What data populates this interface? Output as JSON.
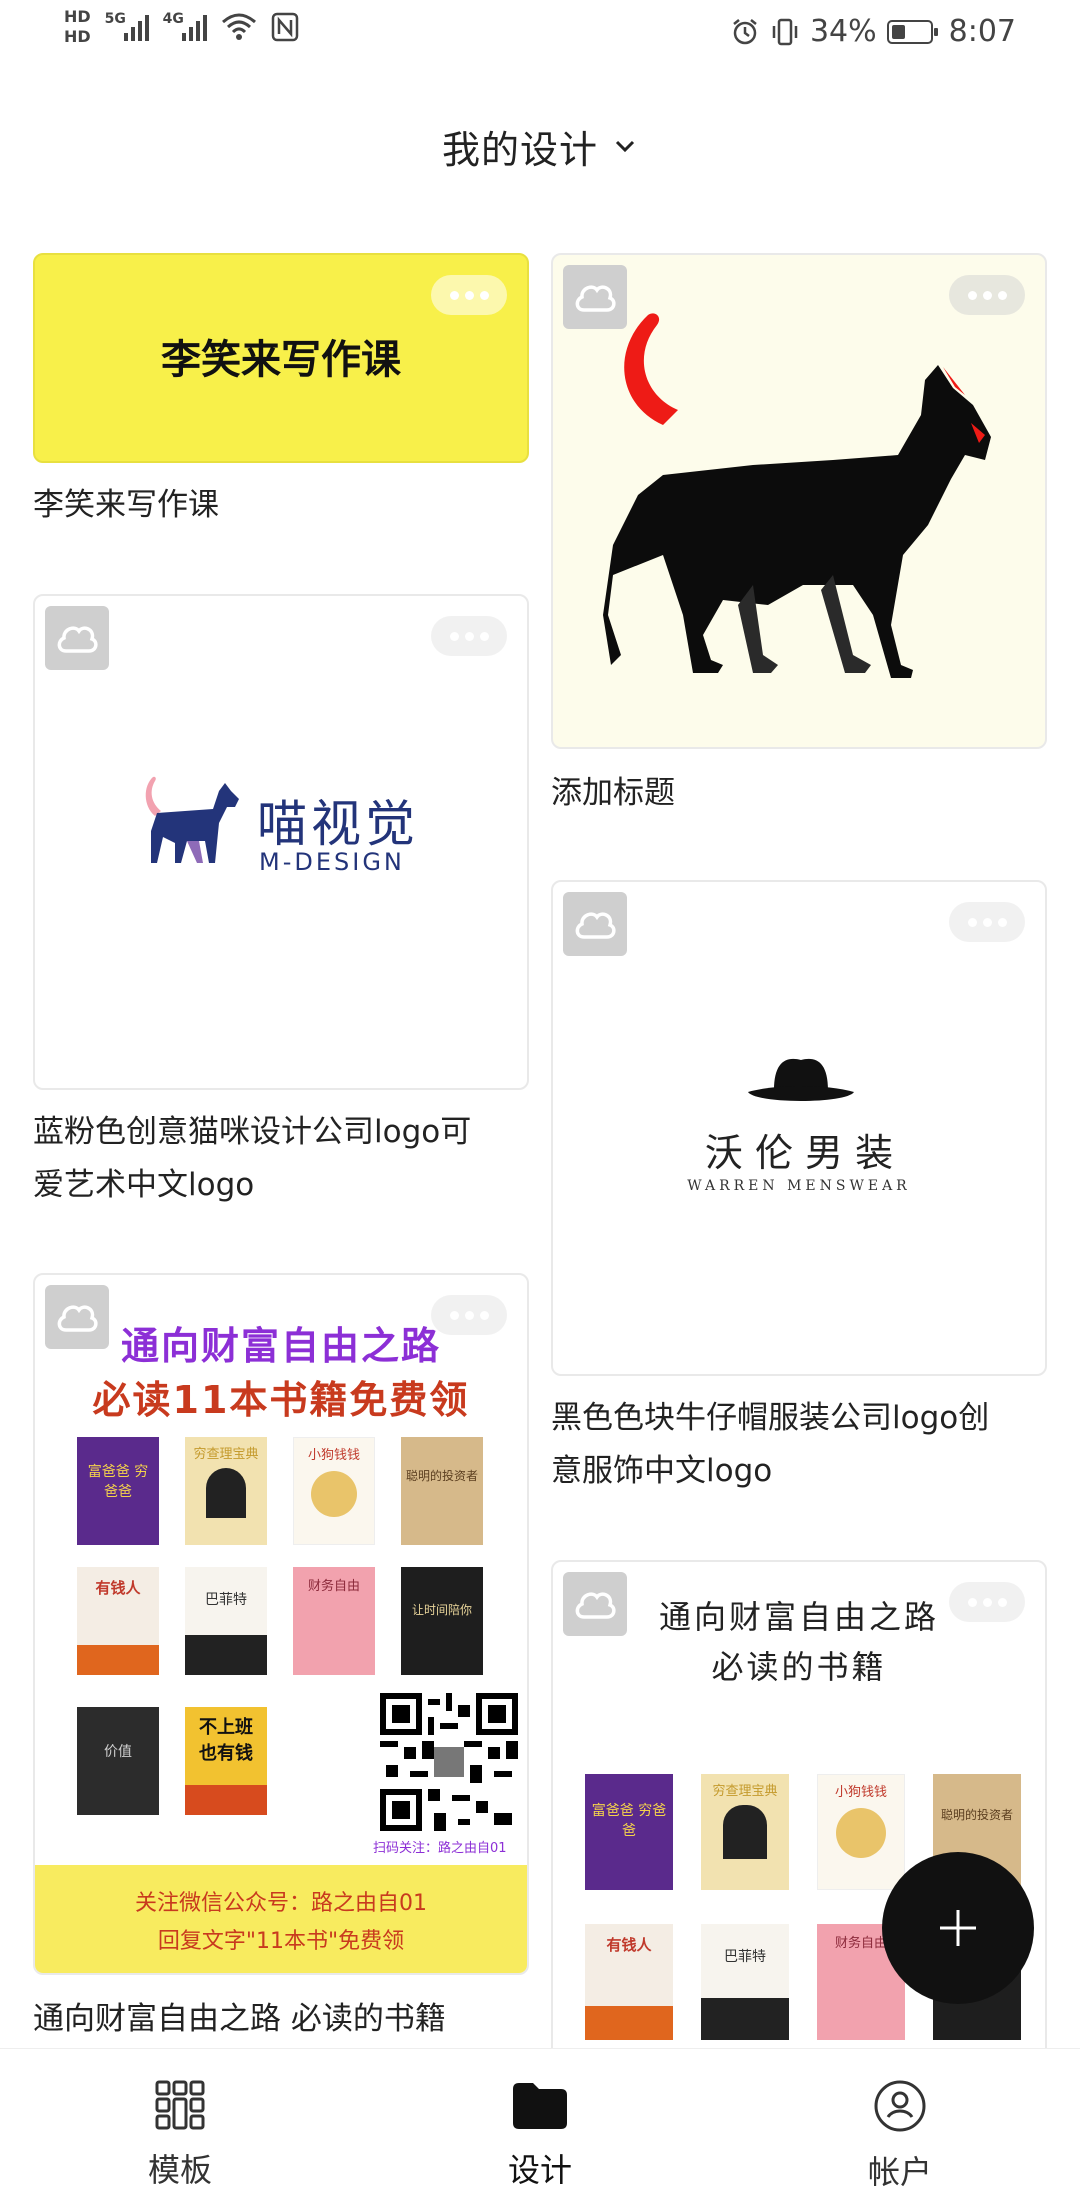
{
  "status_bar": {
    "hd_top": "HD",
    "hd_bottom": "HD",
    "signal1": "5G",
    "signal2": "4G",
    "battery_percent": "34%",
    "time": "8:07"
  },
  "header": {
    "title": "我的设计"
  },
  "cards": [
    {
      "caption": "李笑来写作课",
      "thumb_text": "李笑来写作课"
    },
    {
      "caption": "添加标题"
    },
    {
      "caption_line1": "蓝粉色创意猫咪设计公司logo可",
      "caption_line2": "爱艺术中文logo",
      "logo_cn": "喵视觉",
      "logo_en": "M-DESIGN"
    },
    {
      "caption_line1": "黑色色块牛仔帽服装公司logo创",
      "caption_line2": "意服饰中文logo",
      "logo_cn": "沃 伦 男 装",
      "logo_en": "WARREN MENSWEAR"
    },
    {
      "caption": "通向财富自由之路 必读的书籍",
      "poster_title1": "通向财富自由之路",
      "poster_title2": "必读11本书籍免费领",
      "qr_note": "扫码关注：路之由自01",
      "footer_line1": "关注微信公众号：路之由自01",
      "footer_line2": "回复文字\"11本书\"免费领",
      "books_row1": [
        "富爸爸 穷爸爸",
        "穷查理宝典",
        "小狗钱钱",
        "聪明的投资者"
      ],
      "books_row2": [
        "有钱人",
        "巴菲特",
        "财务自由",
        "让时间陪你"
      ],
      "books_row3": [
        "价值",
        "不上班 也有钱",
        "",
        ""
      ]
    },
    {
      "poster_title1": "通向财富自由之路",
      "poster_title2": "必读的书籍",
      "books_row1": [
        "富爸爸 穷爸爸",
        "穷查理宝典",
        "小狗钱钱",
        "聪明的投资者"
      ],
      "books_row2": [
        "有钱人",
        "巴菲特",
        "财务自由",
        ""
      ]
    }
  ],
  "bottom_nav": [
    {
      "label": "模板",
      "icon": "grid-icon"
    },
    {
      "label": "设计",
      "icon": "folder-icon"
    },
    {
      "label": "帐户",
      "icon": "account-icon"
    }
  ],
  "fab": {
    "icon": "plus-icon"
  },
  "colors": {
    "yellow": "#F8F04A",
    "cat_red": "#EE1B16",
    "navy": "#23347A",
    "purple": "#8C2FD6",
    "poster_yellow": "#F8EB5F"
  }
}
